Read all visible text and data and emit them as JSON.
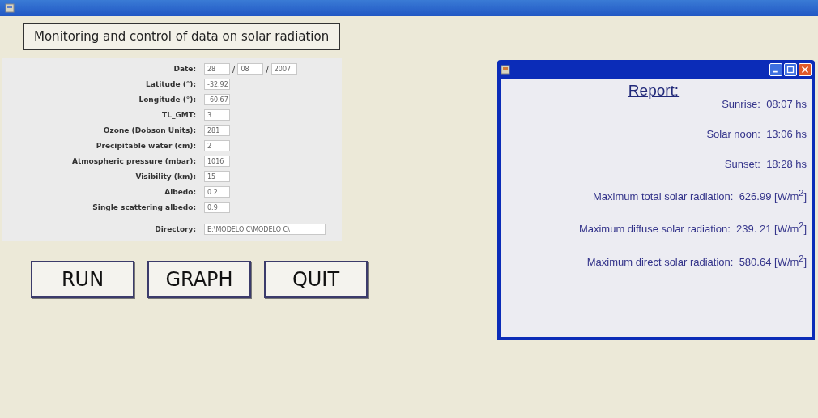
{
  "heading": "Monitoring and control of data on solar radiation",
  "date": {
    "label": "Date:",
    "day": "28",
    "month": "08",
    "year": "2007",
    "separator": "/"
  },
  "fields": [
    {
      "label": "Latitude (°):",
      "value": "-32.92"
    },
    {
      "label": "Longitude (°):",
      "value": "-60.67"
    },
    {
      "label": "TL_GMT:",
      "value": "3"
    },
    {
      "label": "Ozone (Dobson Units):",
      "value": "281"
    },
    {
      "label": "Precipitable water (cm):",
      "value": "2"
    },
    {
      "label": "Atmospheric pressure (mbar):",
      "value": "1016"
    },
    {
      "label": "Visibility (km):",
      "value": "15"
    },
    {
      "label": "Albedo:",
      "value": "0.2"
    },
    {
      "label": "Single scattering albedo:",
      "value": "0.9"
    }
  ],
  "directory": {
    "label": "Directory:",
    "value": "E:\\MODELO C\\MODELO C\\"
  },
  "buttons": [
    "RUN",
    "GRAPH",
    "QUIT"
  ],
  "report": {
    "title": "Report:",
    "lines": [
      {
        "label": "Sunrise:",
        "value": "08:07 hs"
      },
      {
        "label": "Solar noon:",
        "value": "13:06 hs"
      },
      {
        "label": "Sunset:",
        "value": "18:28 hs"
      },
      {
        "label": "Maximum total solar radiation:",
        "value": "626.99 [W/m$^{2}$]"
      },
      {
        "label": "Maximum diffuse solar radiation:",
        "value": "239. 21 [W/m$^{2}$]"
      },
      {
        "label": "Maximum direct solar radiation:",
        "value": "580.64 [W/m$^{2}$]"
      }
    ]
  }
}
